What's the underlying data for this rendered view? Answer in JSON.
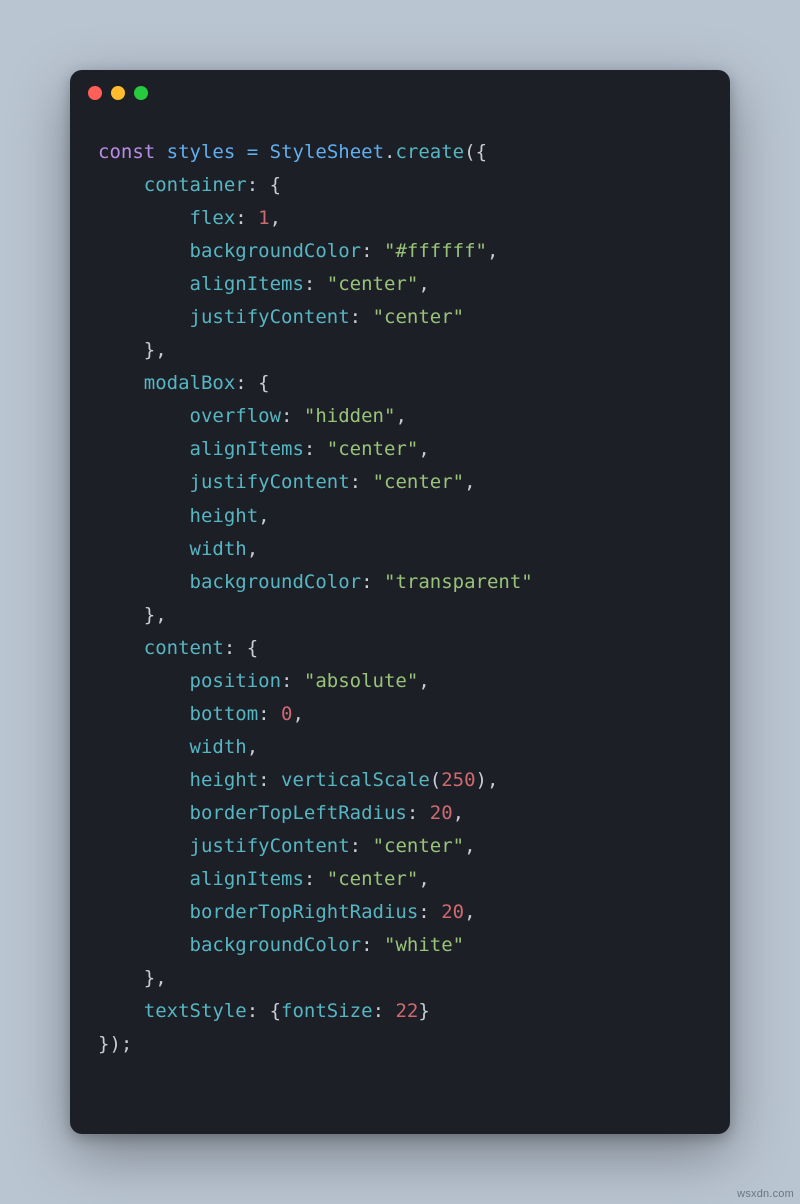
{
  "watermark": "wsxdn.com",
  "code": {
    "tokens": [
      [
        [
          "const ",
          "kw"
        ],
        [
          "styles",
          "var"
        ],
        [
          " ",
          "pun"
        ],
        [
          "=",
          "op"
        ],
        [
          " ",
          "pun"
        ],
        [
          "StyleSheet",
          "var"
        ],
        [
          ".",
          "dot"
        ],
        [
          "create",
          "fn"
        ],
        [
          "({",
          "pun"
        ]
      ],
      [
        [
          "    ",
          "pun"
        ],
        [
          "container",
          "prop"
        ],
        [
          ": {",
          "pun"
        ]
      ],
      [
        [
          "        ",
          "pun"
        ],
        [
          "flex",
          "prop"
        ],
        [
          ": ",
          "pun"
        ],
        [
          "1",
          "num"
        ],
        [
          ",",
          "pun"
        ]
      ],
      [
        [
          "        ",
          "pun"
        ],
        [
          "backgroundColor",
          "prop"
        ],
        [
          ": ",
          "pun"
        ],
        [
          "\"#ffffff\"",
          "str"
        ],
        [
          ",",
          "pun"
        ]
      ],
      [
        [
          "        ",
          "pun"
        ],
        [
          "alignItems",
          "prop"
        ],
        [
          ": ",
          "pun"
        ],
        [
          "\"center\"",
          "str"
        ],
        [
          ",",
          "pun"
        ]
      ],
      [
        [
          "        ",
          "pun"
        ],
        [
          "justifyContent",
          "prop"
        ],
        [
          ": ",
          "pun"
        ],
        [
          "\"center\"",
          "str"
        ]
      ],
      [
        [
          "    },",
          "pun"
        ]
      ],
      [
        [
          "    ",
          "pun"
        ],
        [
          "modalBox",
          "prop"
        ],
        [
          ": {",
          "pun"
        ]
      ],
      [
        [
          "        ",
          "pun"
        ],
        [
          "overflow",
          "prop"
        ],
        [
          ": ",
          "pun"
        ],
        [
          "\"hidden\"",
          "str"
        ],
        [
          ",",
          "pun"
        ]
      ],
      [
        [
          "        ",
          "pun"
        ],
        [
          "alignItems",
          "prop"
        ],
        [
          ": ",
          "pun"
        ],
        [
          "\"center\"",
          "str"
        ],
        [
          ",",
          "pun"
        ]
      ],
      [
        [
          "        ",
          "pun"
        ],
        [
          "justifyContent",
          "prop"
        ],
        [
          ": ",
          "pun"
        ],
        [
          "\"center\"",
          "str"
        ],
        [
          ",",
          "pun"
        ]
      ],
      [
        [
          "        ",
          "pun"
        ],
        [
          "height",
          "prop"
        ],
        [
          ",",
          "pun"
        ]
      ],
      [
        [
          "        ",
          "pun"
        ],
        [
          "width",
          "prop"
        ],
        [
          ",",
          "pun"
        ]
      ],
      [
        [
          "        ",
          "pun"
        ],
        [
          "backgroundColor",
          "prop"
        ],
        [
          ": ",
          "pun"
        ],
        [
          "\"transparent\"",
          "str"
        ]
      ],
      [
        [
          "    },",
          "pun"
        ]
      ],
      [
        [
          "    ",
          "pun"
        ],
        [
          "content",
          "prop"
        ],
        [
          ": {",
          "pun"
        ]
      ],
      [
        [
          "        ",
          "pun"
        ],
        [
          "position",
          "prop"
        ],
        [
          ": ",
          "pun"
        ],
        [
          "\"absolute\"",
          "str"
        ],
        [
          ",",
          "pun"
        ]
      ],
      [
        [
          "        ",
          "pun"
        ],
        [
          "bottom",
          "prop"
        ],
        [
          ": ",
          "pun"
        ],
        [
          "0",
          "num"
        ],
        [
          ",",
          "pun"
        ]
      ],
      [
        [
          "        ",
          "pun"
        ],
        [
          "width",
          "prop"
        ],
        [
          ",",
          "pun"
        ]
      ],
      [
        [
          "        ",
          "pun"
        ],
        [
          "height",
          "prop"
        ],
        [
          ": ",
          "pun"
        ],
        [
          "verticalScale",
          "fn"
        ],
        [
          "(",
          "pun"
        ],
        [
          "250",
          "num"
        ],
        [
          "),",
          "pun"
        ]
      ],
      [
        [
          "        ",
          "pun"
        ],
        [
          "borderTopLeftRadius",
          "prop"
        ],
        [
          ": ",
          "pun"
        ],
        [
          "20",
          "num"
        ],
        [
          ",",
          "pun"
        ]
      ],
      [
        [
          "        ",
          "pun"
        ],
        [
          "justifyContent",
          "prop"
        ],
        [
          ": ",
          "pun"
        ],
        [
          "\"center\"",
          "str"
        ],
        [
          ",",
          "pun"
        ]
      ],
      [
        [
          "        ",
          "pun"
        ],
        [
          "alignItems",
          "prop"
        ],
        [
          ": ",
          "pun"
        ],
        [
          "\"center\"",
          "str"
        ],
        [
          ",",
          "pun"
        ]
      ],
      [
        [
          "        ",
          "pun"
        ],
        [
          "borderTopRightRadius",
          "prop"
        ],
        [
          ": ",
          "pun"
        ],
        [
          "20",
          "num"
        ],
        [
          ",",
          "pun"
        ]
      ],
      [
        [
          "        ",
          "pun"
        ],
        [
          "backgroundColor",
          "prop"
        ],
        [
          ": ",
          "pun"
        ],
        [
          "\"white\"",
          "str"
        ]
      ],
      [
        [
          "    },",
          "pun"
        ]
      ],
      [
        [
          "    ",
          "pun"
        ],
        [
          "textStyle",
          "prop"
        ],
        [
          ": {",
          "pun"
        ],
        [
          "fontSize",
          "prop"
        ],
        [
          ": ",
          "pun"
        ],
        [
          "22",
          "num"
        ],
        [
          "}",
          "pun"
        ]
      ],
      [
        [
          "});",
          "pun"
        ]
      ]
    ]
  }
}
